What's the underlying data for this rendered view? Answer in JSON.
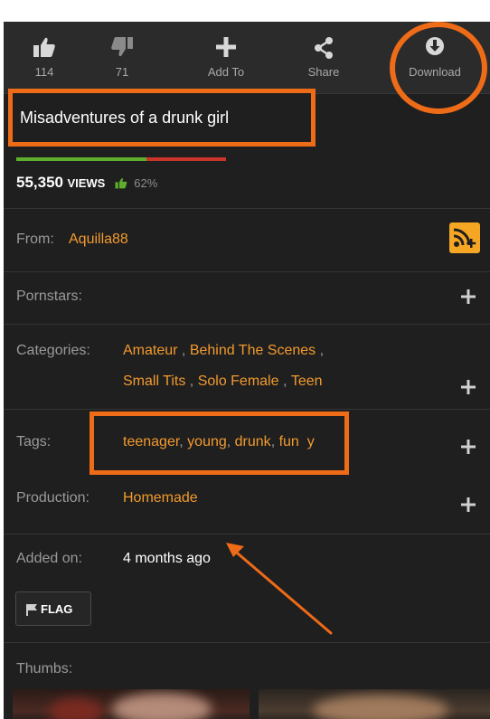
{
  "toolbar": {
    "like_count": "114",
    "dislike_count": "71",
    "add_label": "Add To",
    "share_label": "Share",
    "download_label": "Download"
  },
  "video": {
    "title": "Misadventures of a drunk girl",
    "views": "55,350",
    "views_word": "VIEWS",
    "rating": "62%",
    "rating_fraction": 0.62
  },
  "details": {
    "from_label": "From:",
    "from_value": "Aquilla88",
    "pornstars_label": "Pornstars:",
    "categories_label": "Categories:",
    "categories": [
      "Amateur",
      "Behind The Scenes",
      "Small Tits",
      "Solo Female",
      "Teen"
    ],
    "tags_label": "Tags:",
    "tags": [
      "teenager",
      "young",
      "drunk",
      "fun",
      "y"
    ],
    "production_label": "Production:",
    "production_value": "Homemade",
    "added_label": "Added on:",
    "added_value": "4 months ago"
  },
  "flag_label": "FLAG",
  "thumbs_label": "Thumbs:",
  "colors": {
    "accent": "#f29a2e",
    "annotation": "#ee6b17",
    "rating_good": "#5fae2d",
    "rating_bad": "#c9352b",
    "rss": "#f5a623"
  },
  "icons": [
    "thumbs-up-icon",
    "thumbs-down-icon",
    "plus-icon",
    "share-icon",
    "download-icon",
    "rss-add-icon",
    "flag-icon"
  ]
}
